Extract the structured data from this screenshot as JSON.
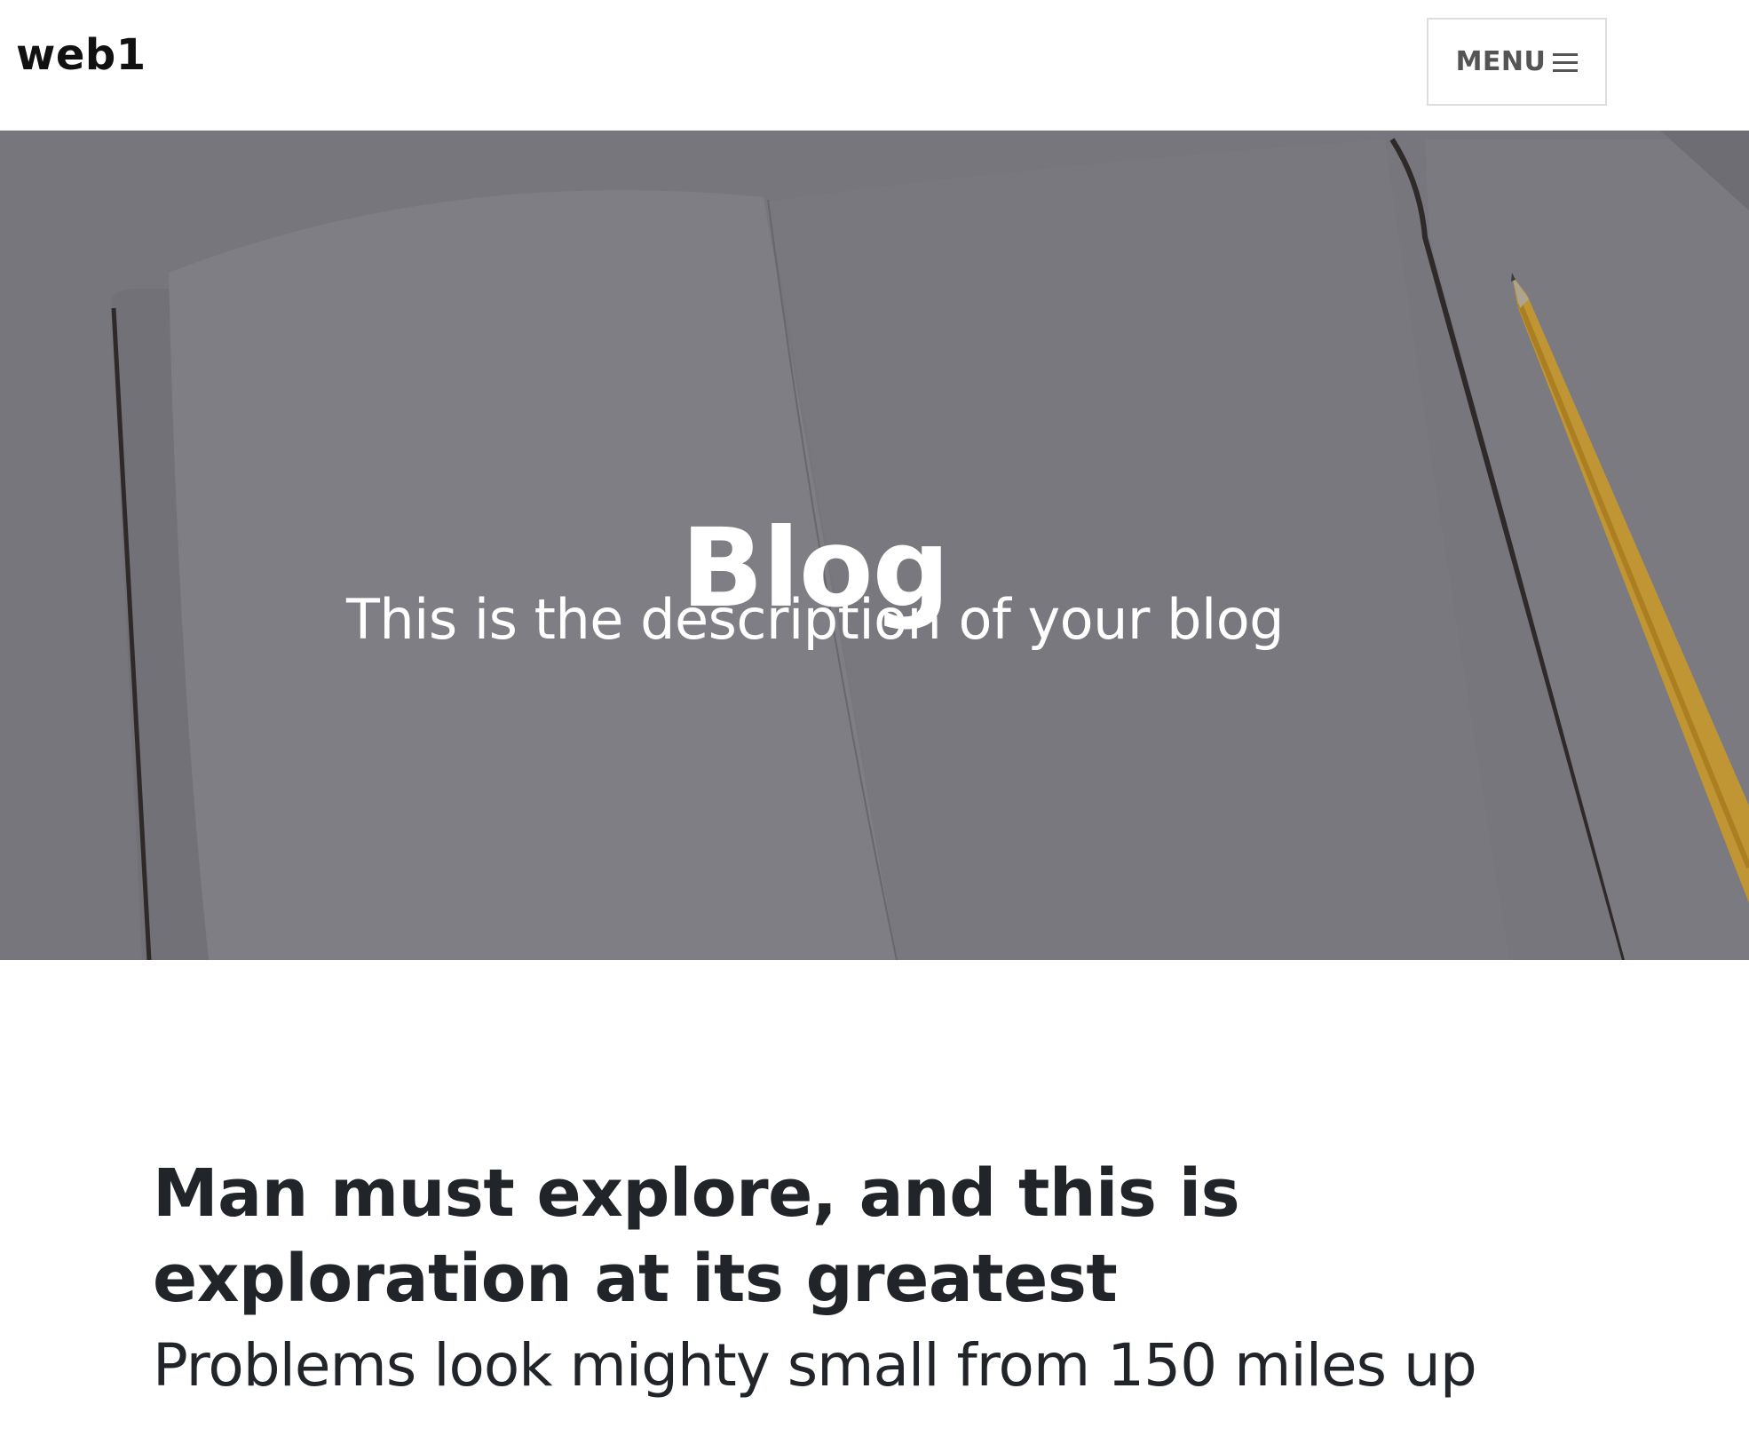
{
  "navbar": {
    "brand": "web1",
    "menu_label": "MENU"
  },
  "hero": {
    "title": "Blog",
    "subtitle": "This is the description of your blog"
  },
  "post": {
    "title": "Man must explore, and this is exploration at its greatest",
    "subtitle": "Problems look mighty small from 150 miles up"
  },
  "icons": {
    "menu": "hamburger-menu-icon"
  },
  "colors": {
    "hero_background": "#848389",
    "text_dark": "#212529",
    "border": "#dddddd"
  }
}
